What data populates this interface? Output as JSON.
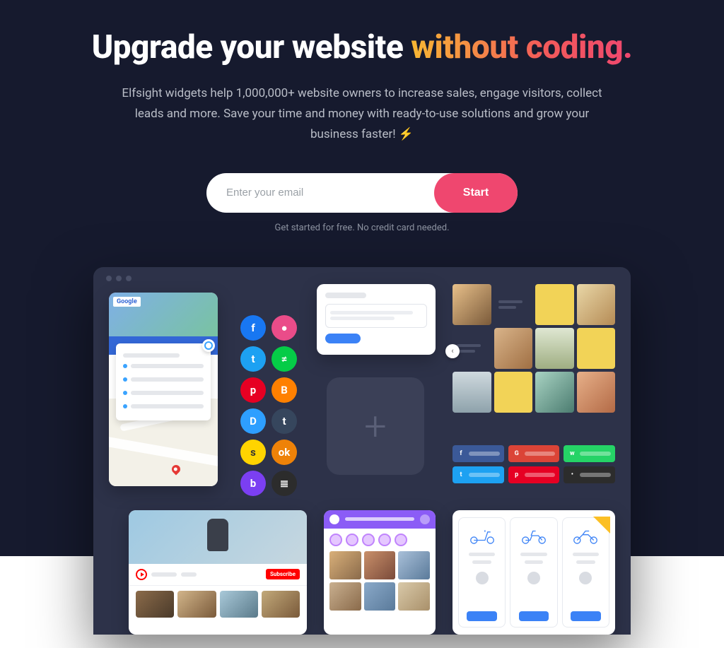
{
  "hero": {
    "headline_plain": "Upgrade your website ",
    "headline_accent": "without coding.",
    "subhead": "Elfsight widgets help 1,000,000+ website owners to increase sales, engage visitors, collect leads and more. Save your time and money with ready-to-use solutions and grow your business faster! ⚡",
    "email_placeholder": "Enter your email",
    "start_label": "Start",
    "note": "Get started for free. No credit card needed."
  },
  "widgets": {
    "map": {
      "brand": "Google"
    },
    "social_icons": [
      {
        "name": "facebook",
        "glyph": "f",
        "bg": "#1877f2"
      },
      {
        "name": "dribbble",
        "glyph": "●",
        "bg": "#ea4c89"
      },
      {
        "name": "twitter",
        "glyph": "t",
        "bg": "#1da1f2"
      },
      {
        "name": "deviantart",
        "glyph": "≠",
        "bg": "#05cc47"
      },
      {
        "name": "pinterest",
        "glyph": "p",
        "bg": "#e60023"
      },
      {
        "name": "blogger",
        "glyph": "B",
        "bg": "#ff8000"
      },
      {
        "name": "disqus",
        "glyph": "D",
        "bg": "#2e9fff"
      },
      {
        "name": "tumblr",
        "glyph": "t",
        "bg": "#36465d"
      },
      {
        "name": "snapchat",
        "glyph": "s",
        "bg": "#ffd400"
      },
      {
        "name": "ok",
        "glyph": "ok",
        "bg": "#ee8208"
      },
      {
        "name": "badoo",
        "glyph": "b",
        "bg": "#7b3ff2"
      },
      {
        "name": "buffer",
        "glyph": "≣",
        "bg": "#2c2c2c"
      }
    ],
    "share_buttons": [
      {
        "name": "facebook",
        "glyph": "f",
        "bg": "#3b5998"
      },
      {
        "name": "google",
        "glyph": "G",
        "bg": "#db4437"
      },
      {
        "name": "whatsapp",
        "glyph": "w",
        "bg": "#25d366"
      },
      {
        "name": "twitter",
        "glyph": "t",
        "bg": "#1da1f2"
      },
      {
        "name": "pinterest",
        "glyph": "p",
        "bg": "#e60023"
      },
      {
        "name": "other",
        "glyph": "•",
        "bg": "#2c2c2c"
      }
    ],
    "youtube": {
      "subscribe": "Subscribe"
    },
    "pricing_items": [
      "scooter",
      "moped",
      "motorcycle"
    ]
  }
}
